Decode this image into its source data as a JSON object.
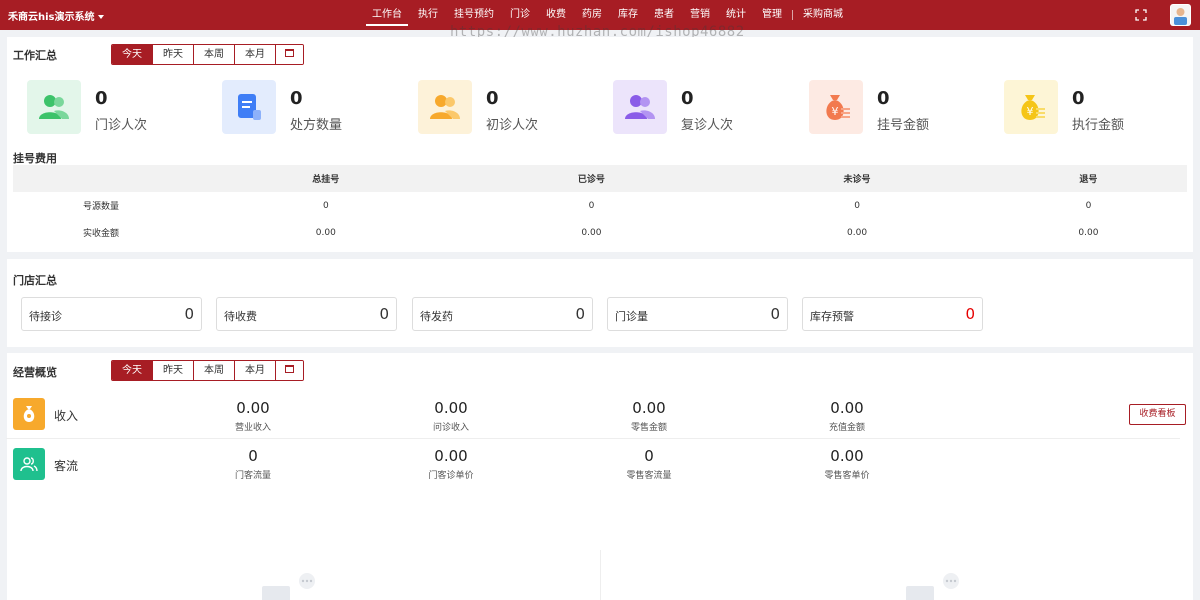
{
  "header": {
    "brand": "禾商云his演示系统",
    "nav": [
      "工作台",
      "执行",
      "挂号预约",
      "门诊",
      "收费",
      "药房",
      "库存",
      "患者",
      "营销",
      "统计",
      "管理"
    ],
    "mall": "采购商城",
    "active_nav": "工作台"
  },
  "watermark": "https://www.huzhan.com/ishop46882",
  "work_summary": {
    "title": "工作汇总",
    "tabs": [
      "今天",
      "昨天",
      "本周",
      "本月"
    ],
    "stats": [
      {
        "value": "0",
        "label": "门诊人次",
        "icon": "users-icon",
        "color": "#3cc36a",
        "bg": "#e3f6ea"
      },
      {
        "value": "0",
        "label": "处方数量",
        "icon": "prescription-icon",
        "color": "#3f7ef6",
        "bg": "#e3ecfd"
      },
      {
        "value": "0",
        "label": "初诊人次",
        "icon": "users-icon",
        "color": "#f7a92c",
        "bg": "#fdf2d9"
      },
      {
        "value": "0",
        "label": "复诊人次",
        "icon": "users-icon",
        "color": "#8a5ce8",
        "bg": "#ece4fb"
      },
      {
        "value": "0",
        "label": "挂号金额",
        "icon": "money-bag-icon",
        "color": "#f27a4f",
        "bg": "#fdeae3"
      },
      {
        "value": "0",
        "label": "执行金额",
        "icon": "money-bag-icon",
        "color": "#f5c518",
        "bg": "#fdf5d6"
      }
    ]
  },
  "registration_fee": {
    "title": "挂号费用",
    "columns": [
      "",
      "总挂号",
      "已诊号",
      "未诊号",
      "退号"
    ],
    "rows": [
      [
        "号源数量",
        "0",
        "0",
        "0",
        "0"
      ],
      [
        "实收金额",
        "0.00",
        "0.00",
        "0.00",
        "0.00"
      ]
    ]
  },
  "store_summary": {
    "title": "门店汇总",
    "cards": [
      {
        "label": "待接诊",
        "value": "0"
      },
      {
        "label": "待收费",
        "value": "0"
      },
      {
        "label": "待发药",
        "value": "0"
      },
      {
        "label": "门诊量",
        "value": "0"
      },
      {
        "label": "库存预警",
        "value": "0",
        "warn": true
      }
    ]
  },
  "business_overview": {
    "title": "经营概览",
    "tabs": [
      "今天",
      "昨天",
      "本周",
      "本月"
    ],
    "board_button": "收费看板",
    "income": {
      "label": "收入",
      "icon_color": "#f7a92c",
      "metrics": [
        {
          "value": "0.00",
          "label": "营业收入"
        },
        {
          "value": "0.00",
          "label": "问诊收入"
        },
        {
          "value": "0.00",
          "label": "零售金额"
        },
        {
          "value": "0.00",
          "label": "充值金额"
        }
      ]
    },
    "traffic": {
      "label": "客流",
      "icon_color": "#1fc08e",
      "metrics": [
        {
          "value": "0",
          "label": "门客流量"
        },
        {
          "value": "0.00",
          "label": "门客诊单价"
        },
        {
          "value": "0",
          "label": "零售客流量"
        },
        {
          "value": "0.00",
          "label": "零售客单价"
        }
      ]
    }
  }
}
